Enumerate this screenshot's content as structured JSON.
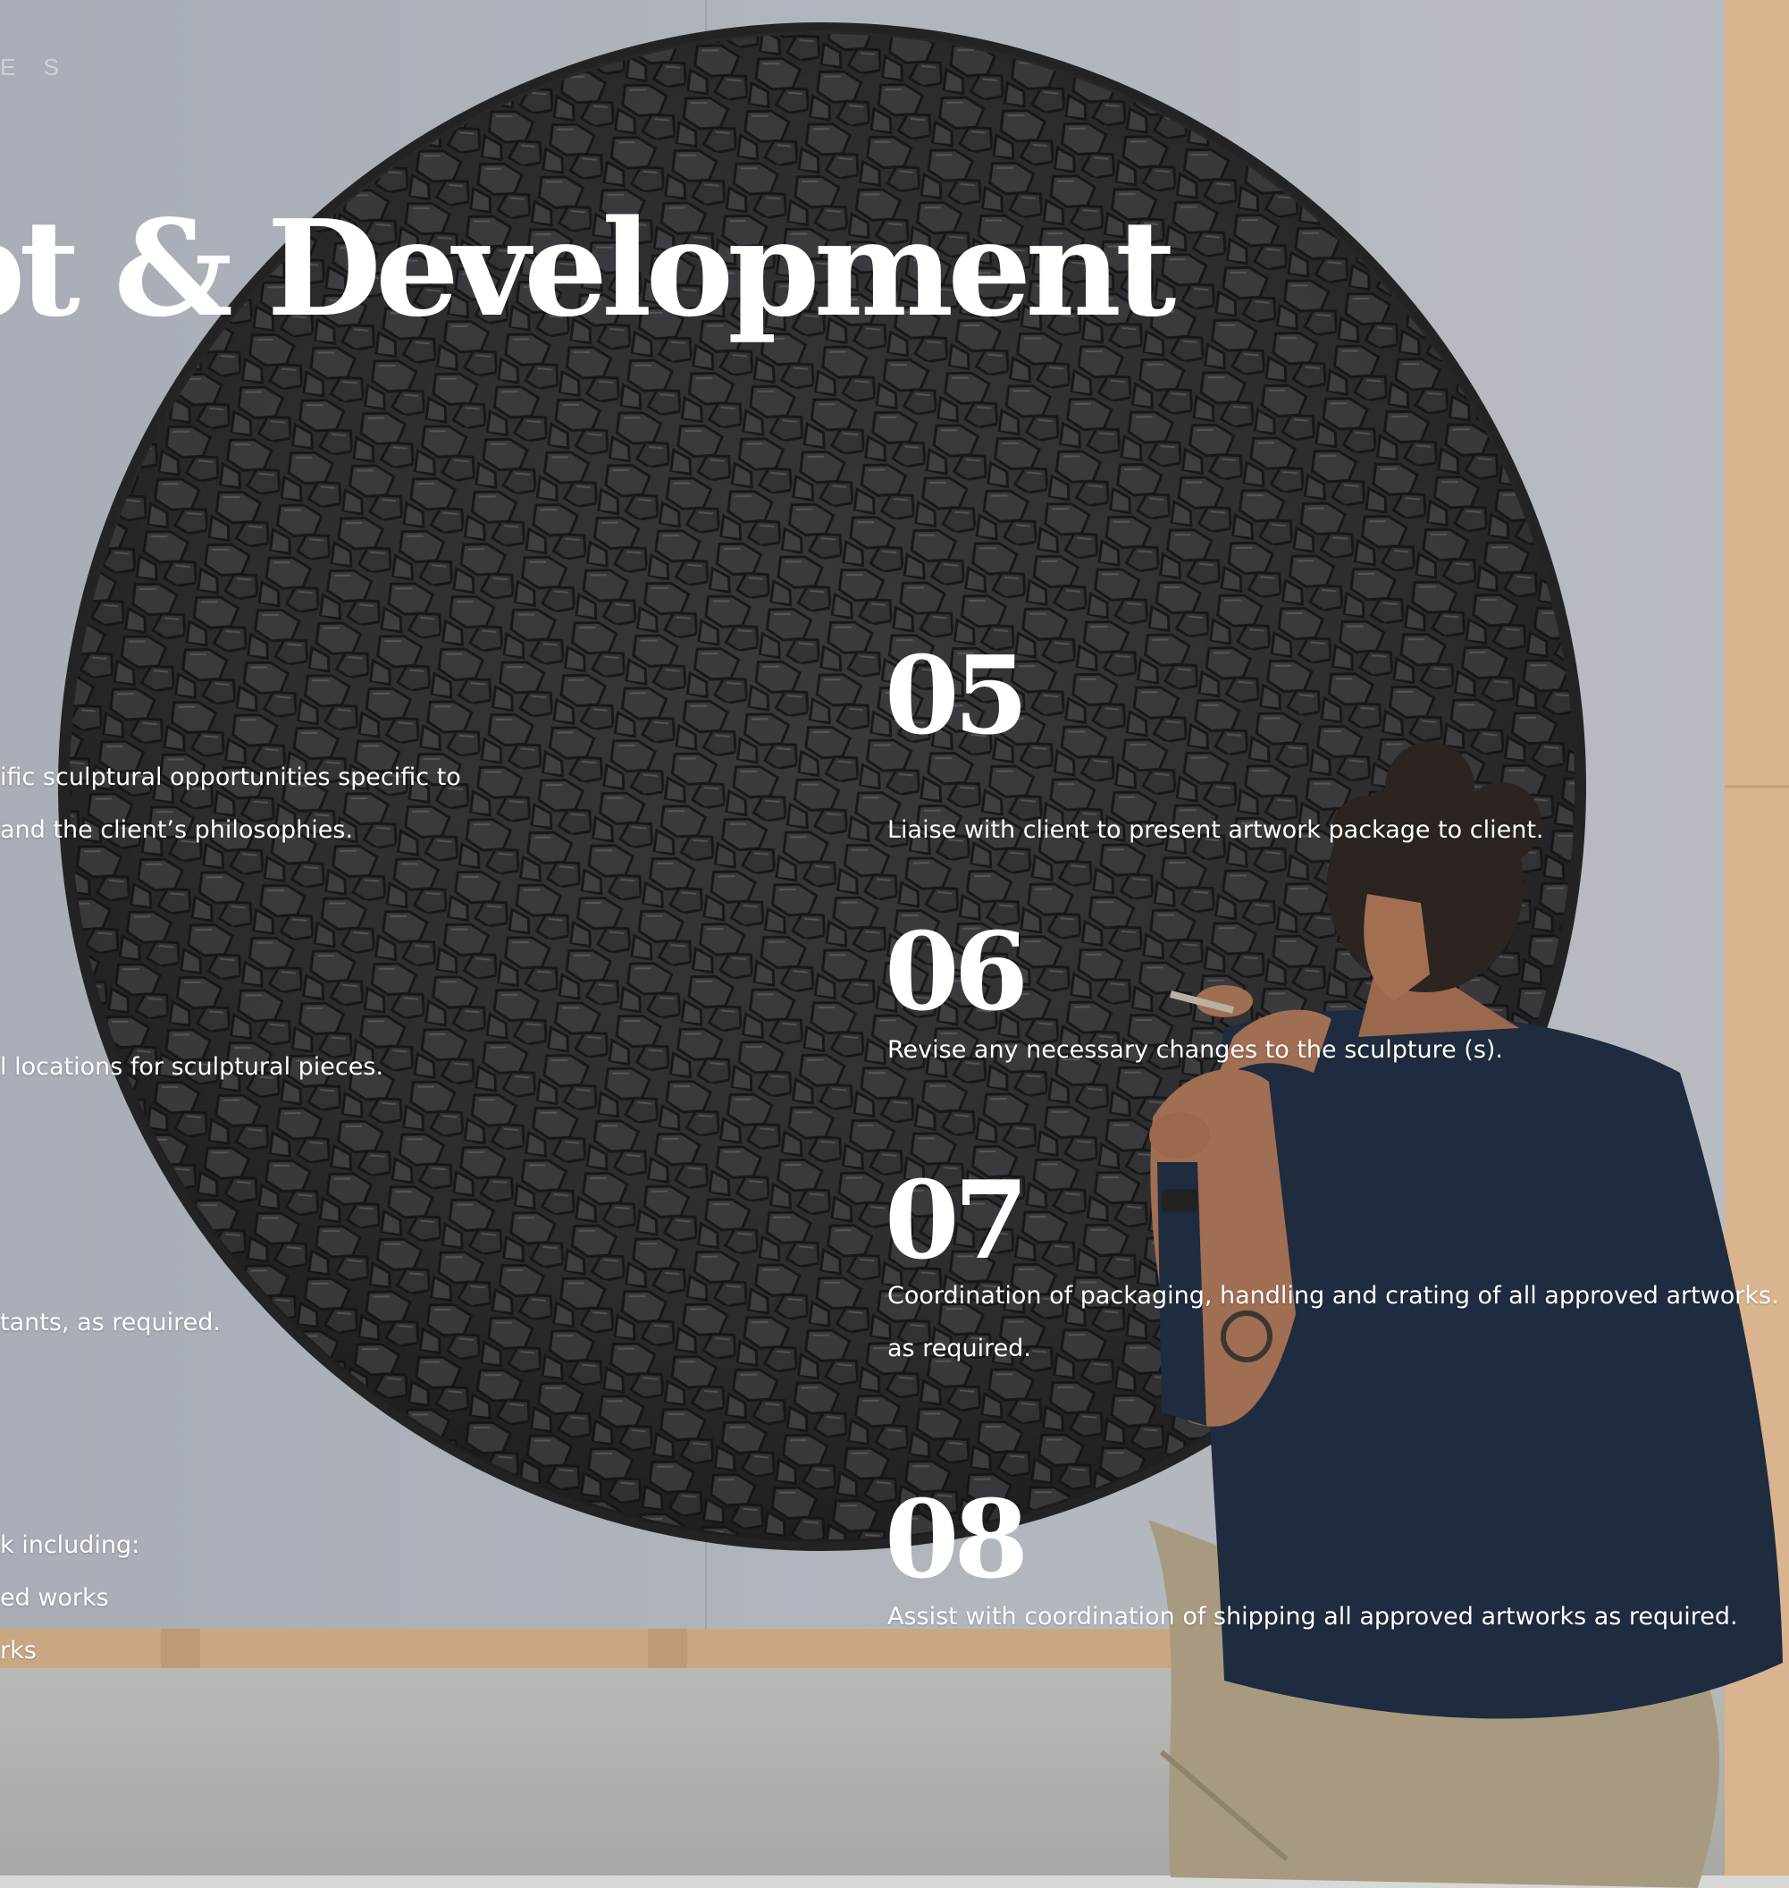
{
  "header": {
    "section_label": "E S",
    "title": "pt & Development"
  },
  "left_column": {
    "line_1": "ific sculptural opportunities specific to",
    "line_2": "and the client’s philosophies.",
    "line_3": "l locations for sculptural pieces.",
    "line_4": "tants, as required.",
    "line_5": "k including:",
    "line_6": "ed works",
    "line_7": "rks"
  },
  "steps": [
    {
      "number": "05",
      "text": "Liaise with client to present artwork package to client."
    },
    {
      "number": "06",
      "text": "Revise any necessary changes to the sculpture (s)."
    },
    {
      "number": "07",
      "text": "Coordination of packaging, handling and crating of all approved artworks.",
      "text_2": "as required."
    },
    {
      "number": "08",
      "text": "Assist with coordination of shipping all approved artworks as required."
    }
  ],
  "colors": {
    "wall": "#aeb2b9",
    "sculpture": "#2f2f31",
    "plywood": "#d9b48e",
    "floor": "#b4b4b0",
    "shirt": "#1f2b3f",
    "trousers": "#a89a80",
    "text": "#ffffff"
  }
}
